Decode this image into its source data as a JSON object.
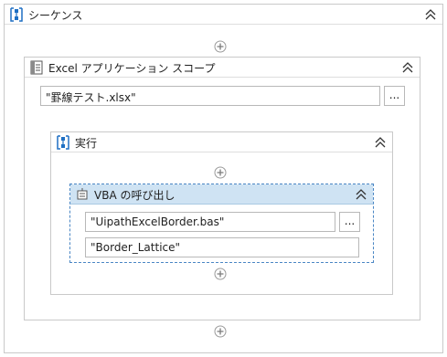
{
  "sequence": {
    "title": "シーケンス",
    "icon": "sequence-icon"
  },
  "excel_scope": {
    "title": "Excel アプリケーション スコープ",
    "icon": "excel-scope-icon",
    "workbook_path": "\"罫線テスト.xlsx\"",
    "browse_label": "..."
  },
  "execute": {
    "title": "実行",
    "icon": "sequence-icon"
  },
  "invoke_vba": {
    "title": "VBA の呼び出し",
    "icon": "invoke-vba-icon",
    "code_file": "\"UipathExcelBorder.bas\"",
    "browse_label": "...",
    "method_name": "\"Border_Lattice\""
  },
  "colors": {
    "selected_header": "#cfe3f3",
    "selected_border": "#4a86c4",
    "icon_blue": "#1e6fc3"
  }
}
